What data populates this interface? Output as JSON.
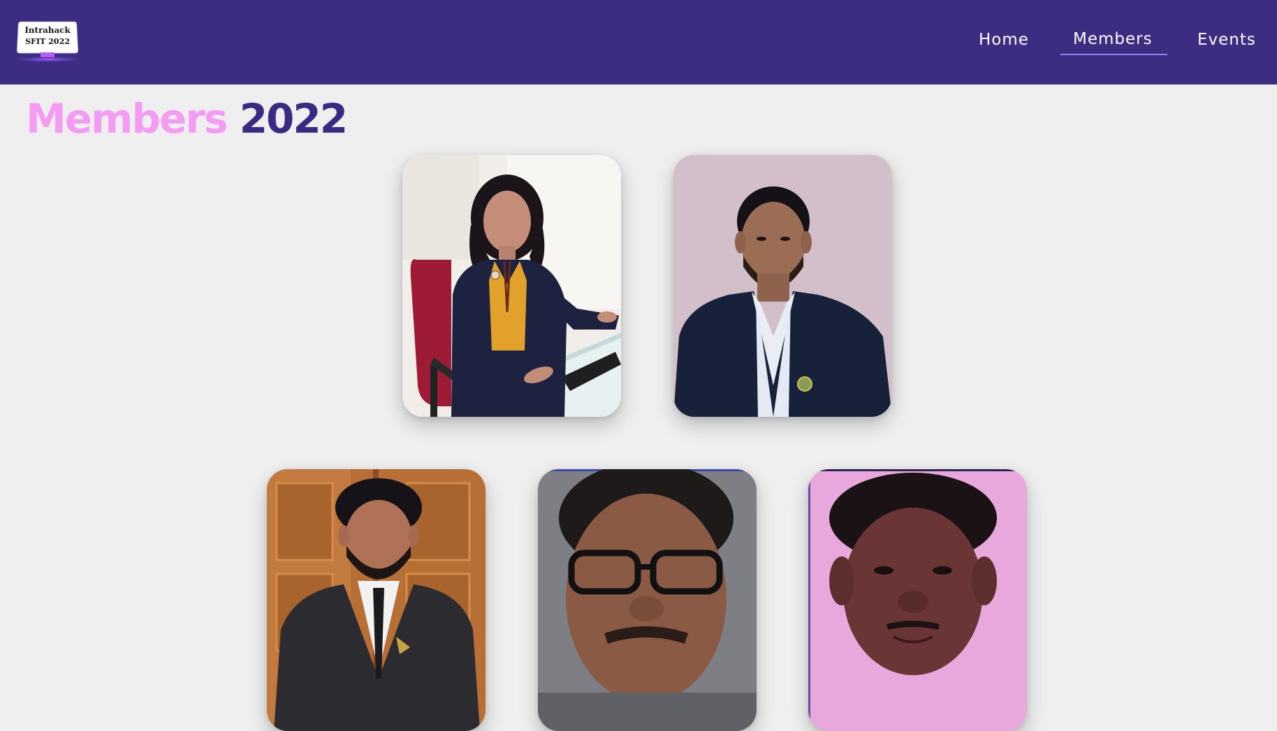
{
  "logo": {
    "line1": "Intrahack",
    "line2": "SFIT 2022"
  },
  "nav": {
    "items": [
      {
        "label": "Home",
        "active": false
      },
      {
        "label": "Members",
        "active": true
      },
      {
        "label": "Events",
        "active": false
      }
    ]
  },
  "page": {
    "title_part1": "Members",
    "title_part2": "2022"
  },
  "colors": {
    "navbar": "#3c2d82",
    "background": "#efefef",
    "title_accent": "#f49cf4",
    "title_primary": "#3a2a82",
    "nav_underline": "#9a7cf0"
  },
  "members": [
    {
      "photo": "member-photo-woman-at-desk"
    },
    {
      "photo": "member-photo-man-in-blazer"
    },
    {
      "photo": "member-photo-man-in-suit"
    },
    {
      "photo": "member-photo-man-with-glasses"
    },
    {
      "photo": "member-photo-man-pink-wall"
    }
  ]
}
